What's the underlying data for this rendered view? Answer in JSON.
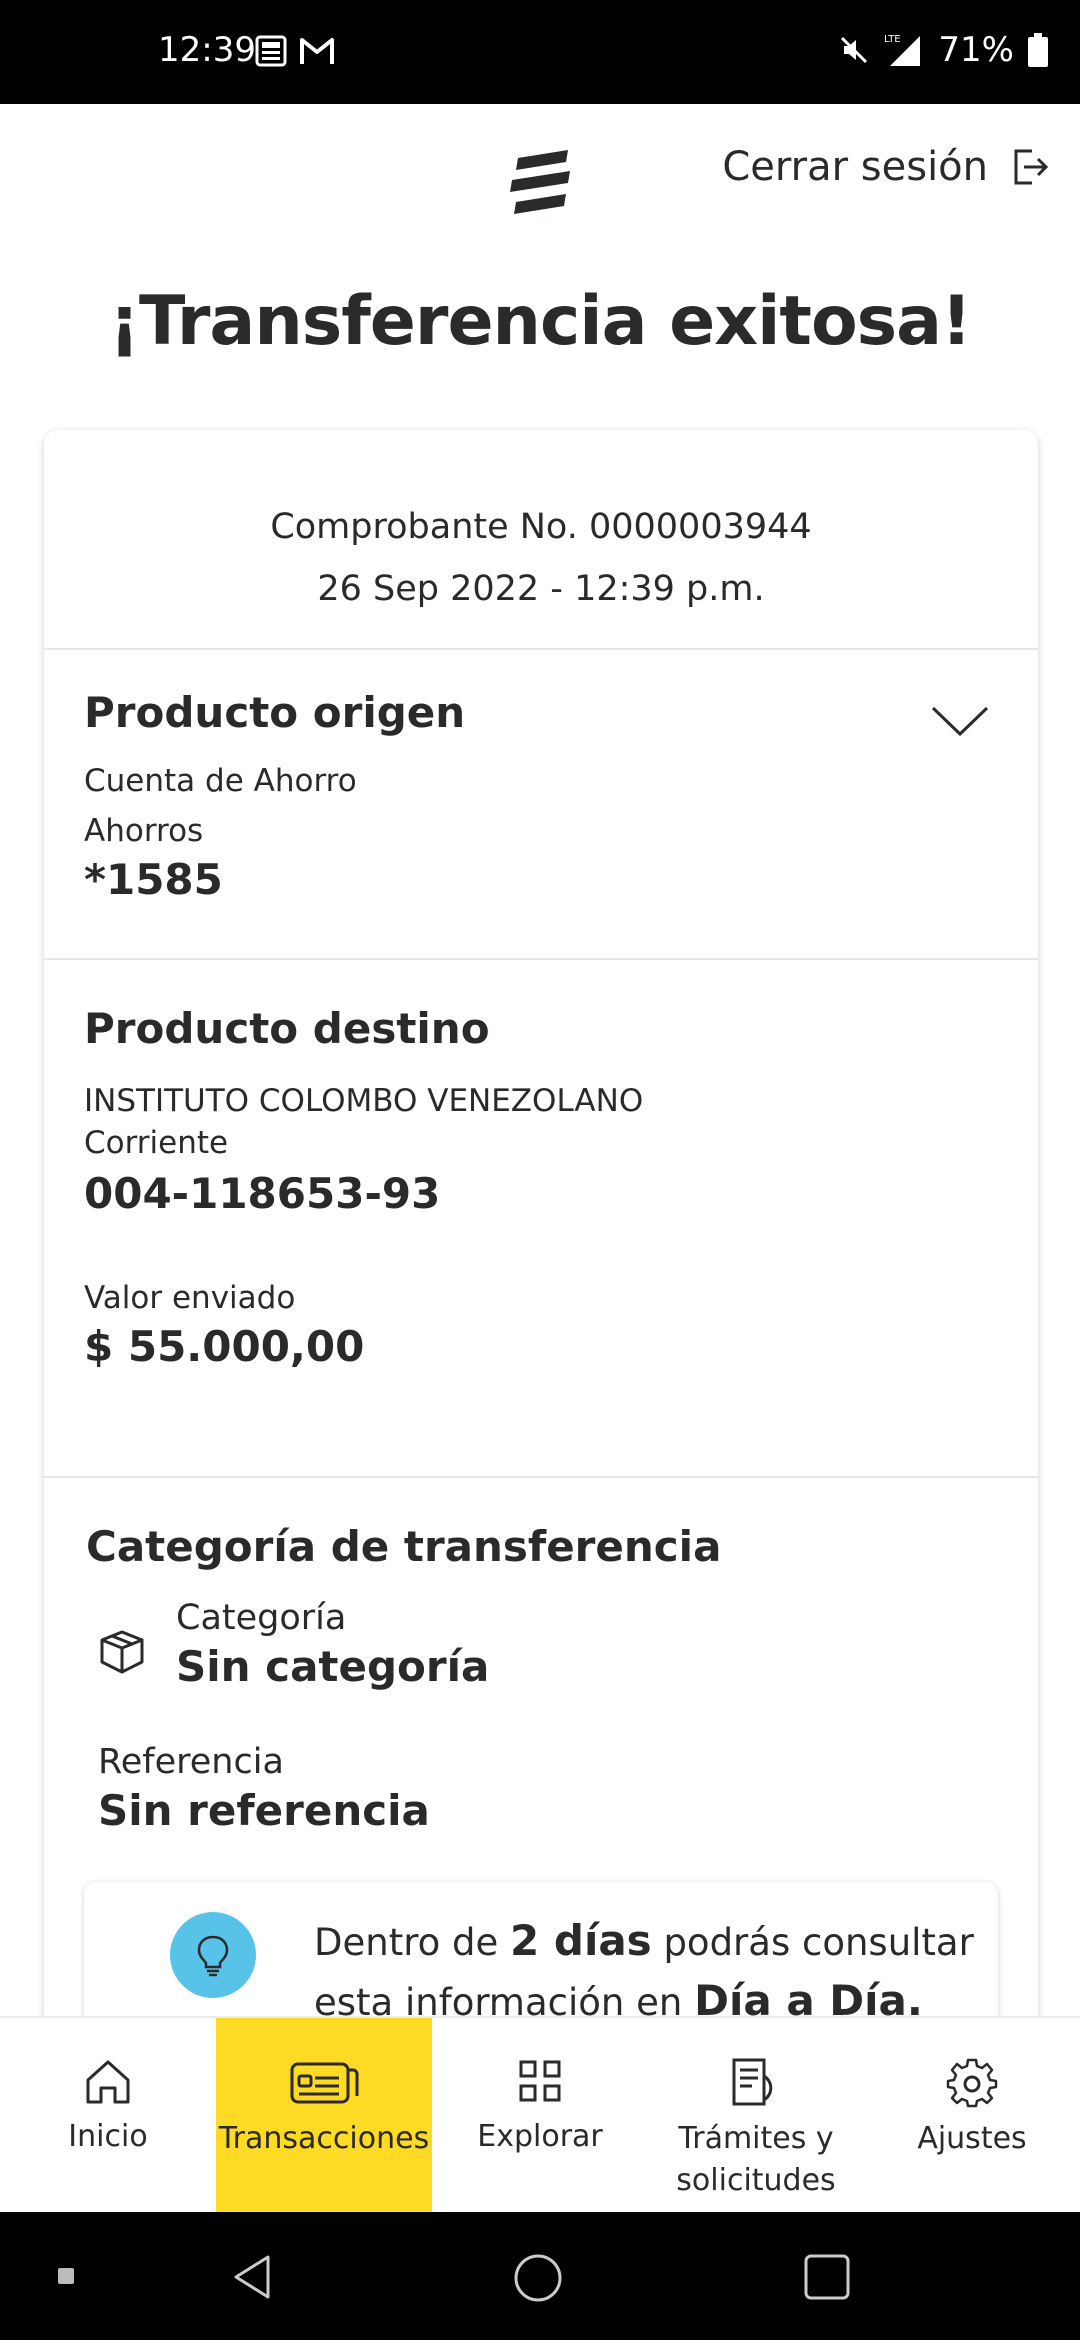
{
  "status_bar": {
    "time": "12:39",
    "network": "LTE",
    "battery": "71%"
  },
  "header": {
    "logout_label": "Cerrar sesión"
  },
  "title": "¡Transferencia exitosa!",
  "receipt": {
    "number_line": "Comprobante No. 0000003944",
    "date_line": "26 Sep 2022 - 12:39 p.m."
  },
  "origin": {
    "title": "Producto origen",
    "account_type": "Cuenta de Ahorro",
    "subtype": "Ahorros",
    "number": "*1585"
  },
  "destination": {
    "title": "Producto destino",
    "name": "INSTITUTO COLOMBO VENEZOLANO",
    "type": "Corriente",
    "number": "004-118653-93",
    "amount_label": "Valor enviado",
    "amount": "$ 55.000,00"
  },
  "category": {
    "title": "Categoría de transferencia",
    "category_label": "Categoría",
    "category_value": "Sin categoría",
    "reference_label": "Referencia",
    "reference_value": "Sin referencia"
  },
  "info": {
    "text_1": "Dentro de ",
    "bold_1": "2 días",
    "text_2": " podrás consultar esta información en ",
    "bold_2": "Día a Día."
  },
  "bottom_nav": [
    {
      "label": "Inicio",
      "icon": "home-icon"
    },
    {
      "label": "Transacciones",
      "icon": "transactions-icon",
      "active": true
    },
    {
      "label": "Explorar",
      "icon": "grid-icon"
    },
    {
      "label": "Trámites y solicitudes",
      "icon": "documents-icon"
    },
    {
      "label": "Ajustes",
      "icon": "gear-icon"
    }
  ],
  "colors": {
    "accent_yellow": "#fdda24",
    "brand_green": "#2bc489",
    "bulb_blue": "#58c3e8",
    "text_dark": "#2c2a29"
  }
}
